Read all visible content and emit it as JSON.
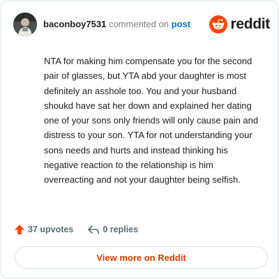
{
  "header": {
    "username": "baconboy7531",
    "action_text": "commented on",
    "post_link": "post",
    "avatar_icon": "user-avatar",
    "brand_icon": "reddit-alien-icon",
    "brand_word": "reddit",
    "brand_color": "#ff4500"
  },
  "comment": {
    "body": "NTA for making him compensate you for the second pair of glasses, but YTA abd your daughter is most definitely an asshole too. You and your husband shoukd have sat her down and explained her dating one of your sons only friends will only cause pain and distress to your son. YTA for not understanding your sons needs and hurts and instead thinking his negative reaction to the relationship is him overreacting and not your daughter being selfish."
  },
  "actions": {
    "upvotes_icon": "upvote-arrow-icon",
    "upvotes_label": "37 upvotes",
    "replies_icon": "reply-arrow-icon",
    "replies_label": "0 replies"
  },
  "footer": {
    "view_button_label": "View more on Reddit",
    "accent_color": "#d93a00"
  }
}
